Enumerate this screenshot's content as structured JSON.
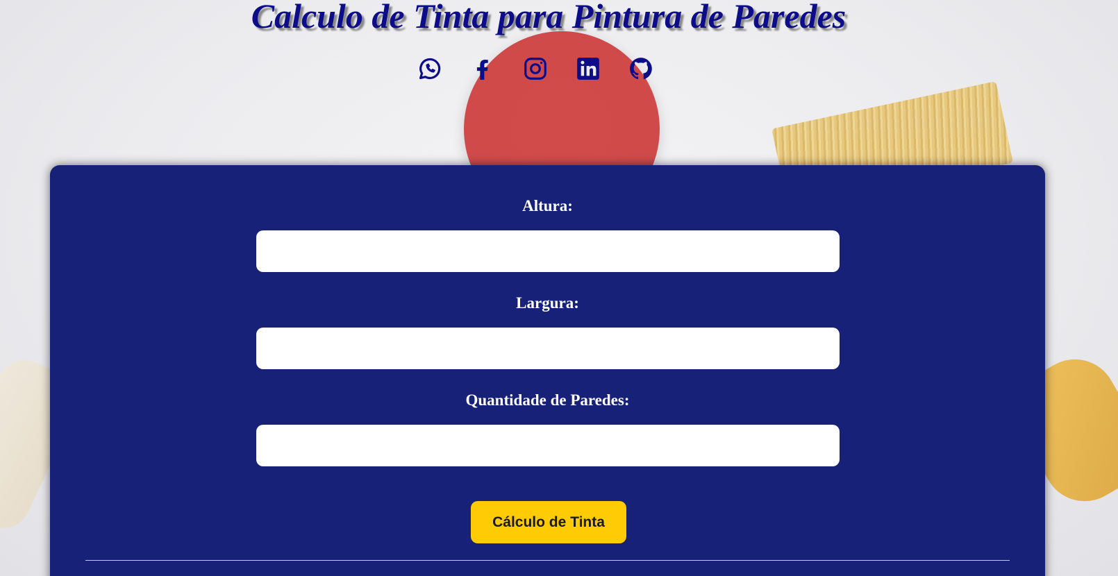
{
  "header": {
    "title": "Calculo de Tinta para Pintura de Paredes",
    "social_icons": [
      "whatsapp-icon",
      "facebook-icon",
      "instagram-icon",
      "linkedin-icon",
      "github-icon"
    ]
  },
  "form": {
    "height_label": "Altura:",
    "height_value": "",
    "width_label": "Largura:",
    "width_value": "",
    "walls_label": "Quantidade de Paredes:",
    "walls_value": "",
    "submit_label": "Cálculo de Tinta"
  },
  "colors": {
    "title": "#0d0d8a",
    "card_background": "#162177",
    "button": "#ffcb05",
    "icon": "#0d0d8a"
  }
}
